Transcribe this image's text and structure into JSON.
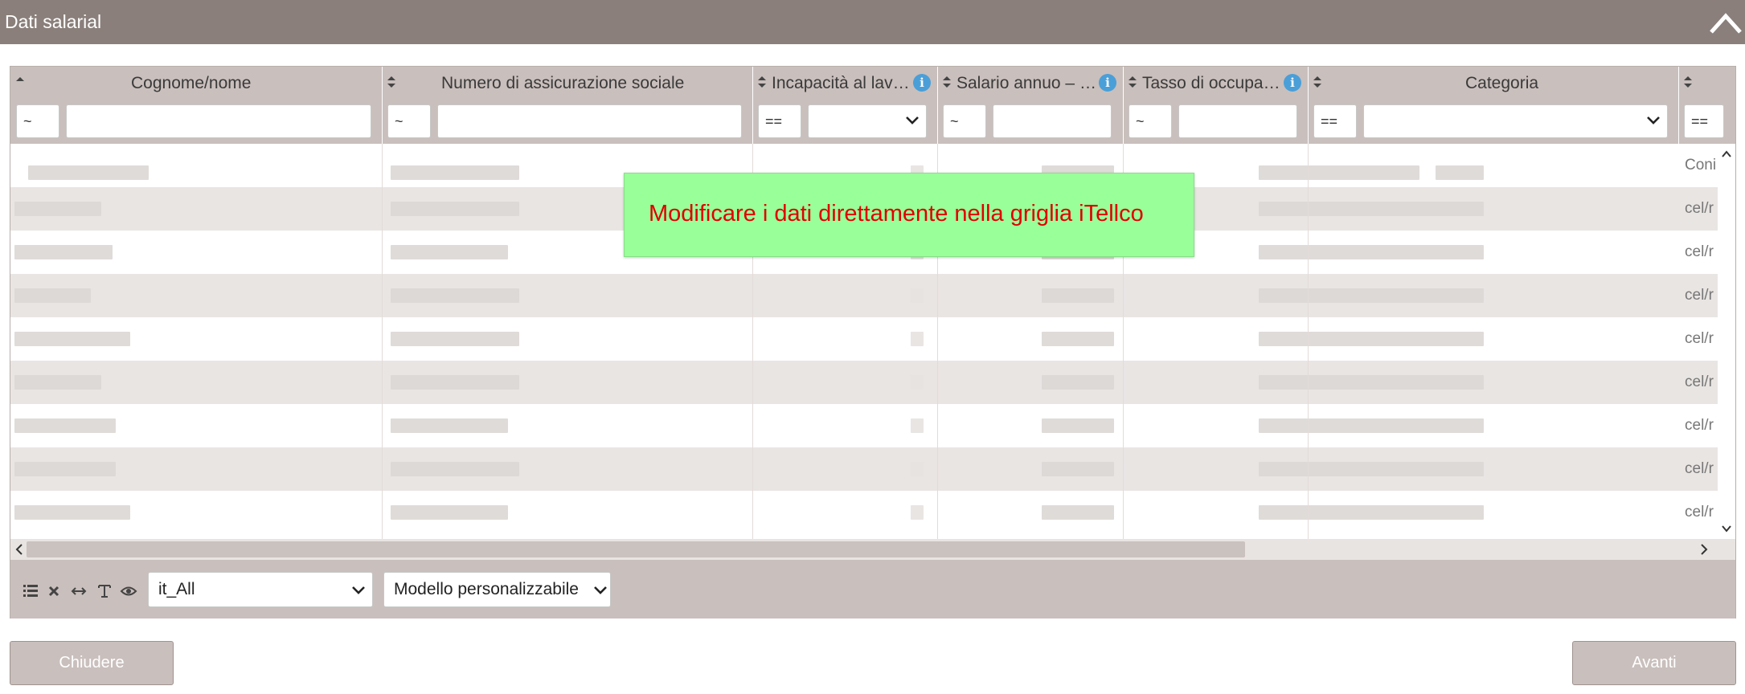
{
  "window": {
    "title": "Dati salarial"
  },
  "grid": {
    "columns": [
      {
        "label": "Cognome/nome",
        "filter_op": "~",
        "filter_value": ""
      },
      {
        "label": "Numero di assicurazione sociale",
        "filter_op": "~",
        "filter_value": ""
      },
      {
        "label": "Incapacità al lav…",
        "filter_op": "==",
        "filter_value": ""
      },
      {
        "label": "Salario annuo – …",
        "filter_op": "~",
        "filter_value": ""
      },
      {
        "label": "Tasso di occupa…",
        "filter_op": "~",
        "filter_value": ""
      },
      {
        "label": "Categoria",
        "filter_op": "==",
        "filter_value": ""
      },
      {
        "label": "",
        "filter_op": "==",
        "filter_value": ""
      }
    ],
    "info_glyph": "i",
    "peek_cells": [
      "Coni",
      "cel/r",
      "cel/r",
      "cel/r",
      "cel/r",
      "cel/r",
      "cel/r",
      "cel/r",
      "cel/r"
    ]
  },
  "toolbar": {
    "language_select": "it_All",
    "model_select": "Modello personalizzabile",
    "icons": [
      "list-icon",
      "clear-icon",
      "resize-icon",
      "text-format-icon",
      "eye-icon"
    ]
  },
  "notice": {
    "message": "Modificare i dati direttamente nella griglia iTellco",
    "background": "#99ff99",
    "color": "#e00000"
  },
  "buttons": {
    "close": "Chiudere",
    "next": "Avanti"
  },
  "colors": {
    "header": "#8a7f7a",
    "grid_header": "#c9bfbc",
    "info": "#4a9fd8"
  }
}
